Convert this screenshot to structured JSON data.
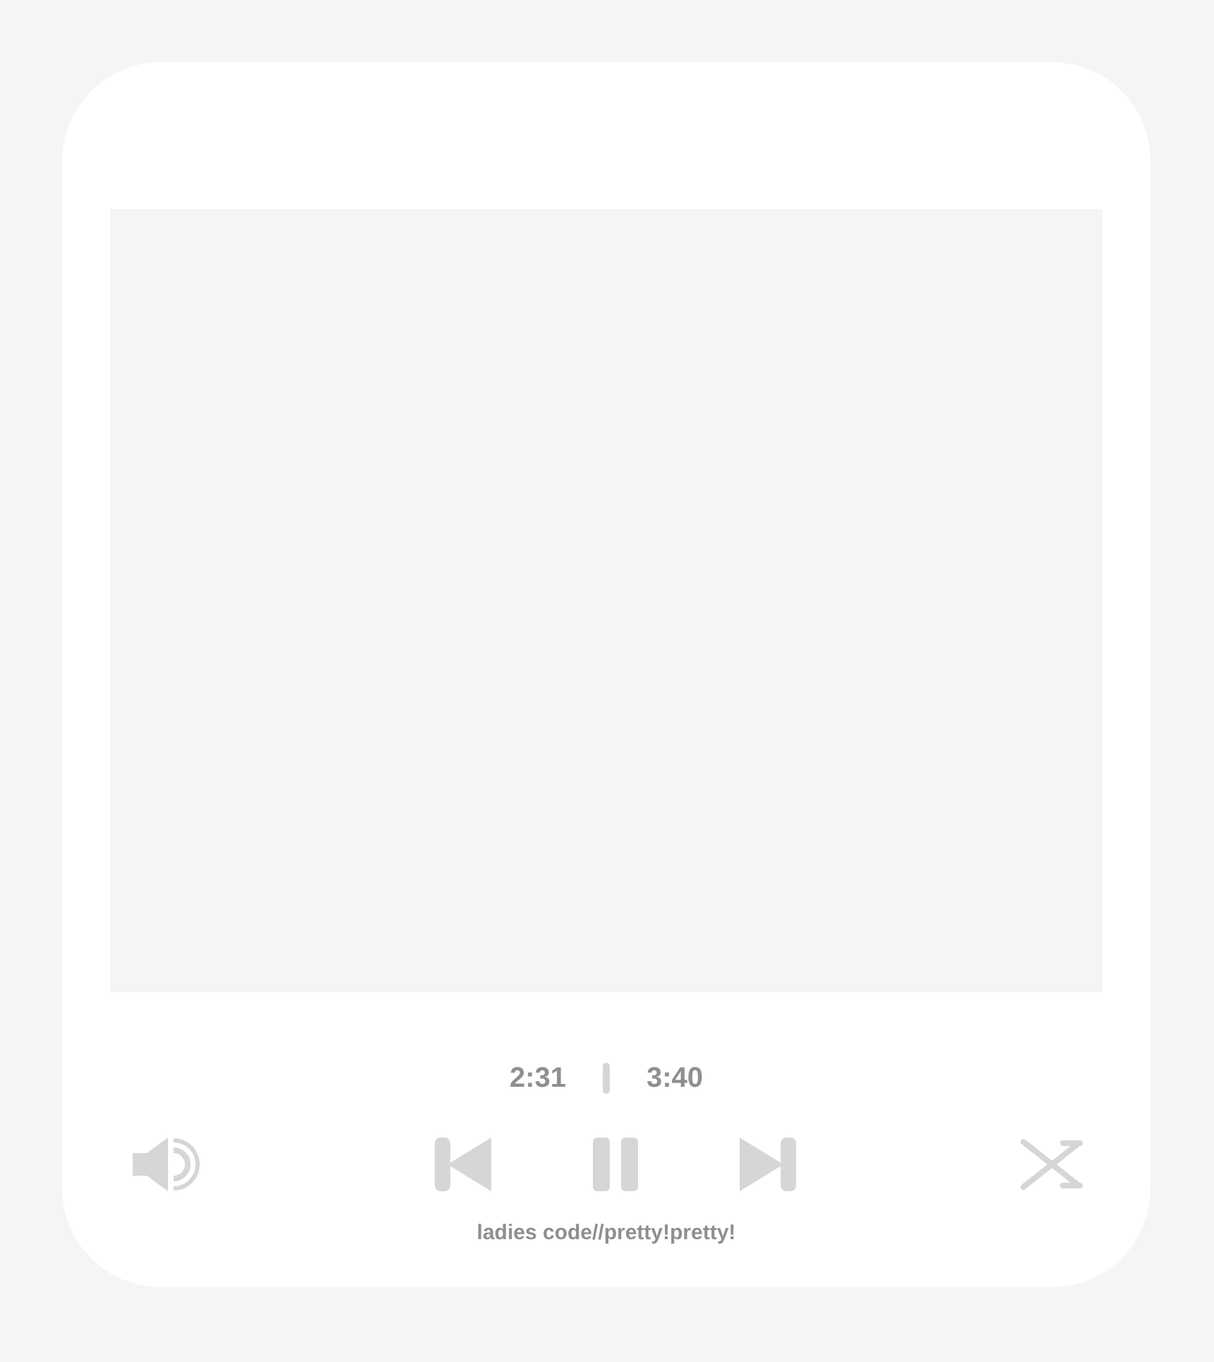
{
  "player": {
    "playing": true,
    "elapsed": "2:31",
    "duration": "3:40",
    "title": "ladies code//pretty!pretty!"
  }
}
